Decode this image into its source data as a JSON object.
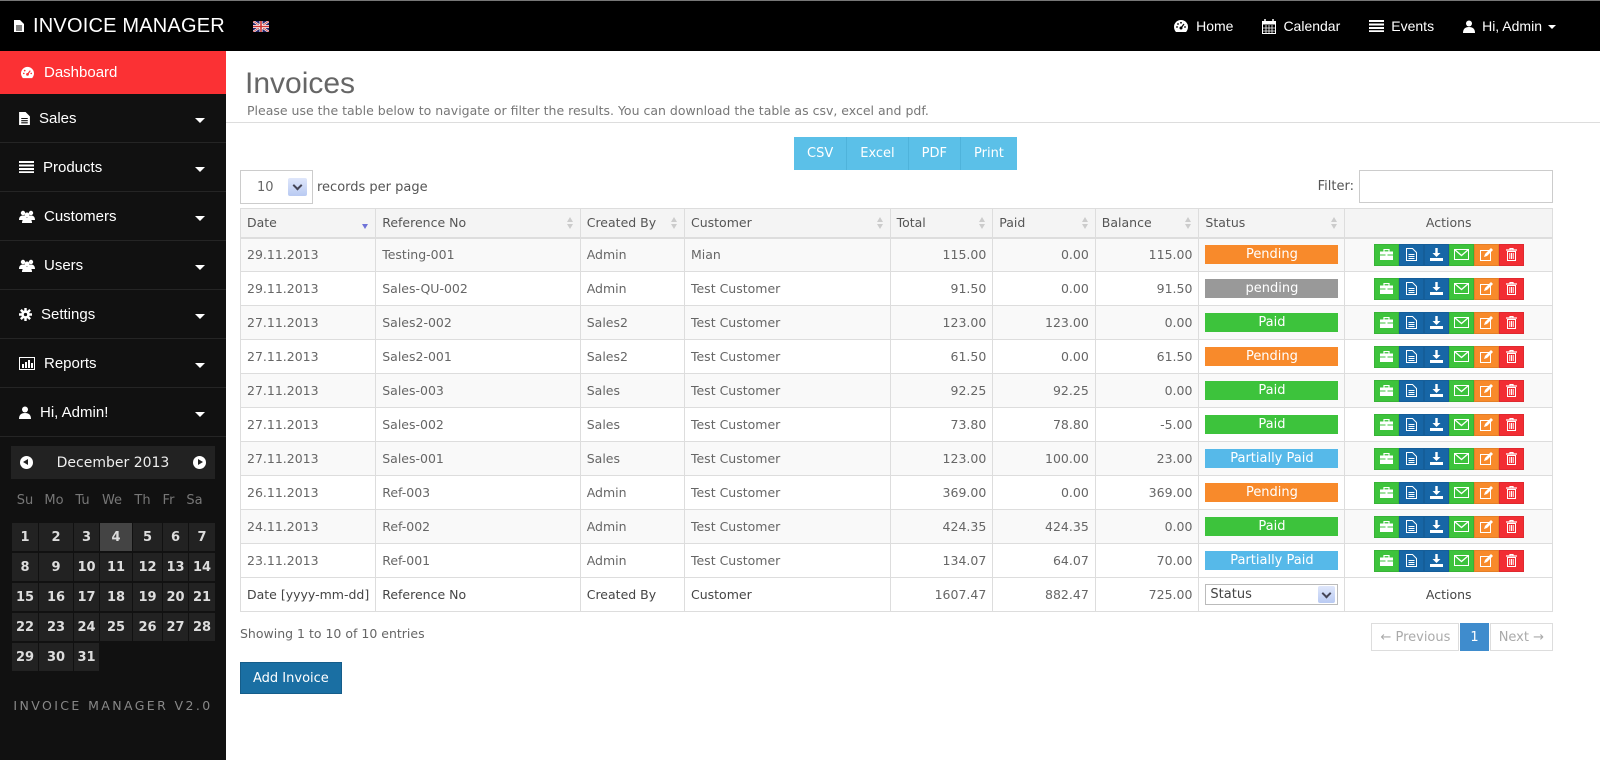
{
  "app": {
    "title": "INVOICE MANAGER",
    "version": "INVOICE MANAGER V2.0"
  },
  "topnav": {
    "items": [
      {
        "label": "Home",
        "icon": "dashboard-icon"
      },
      {
        "label": "Calendar",
        "icon": "calendar-icon"
      },
      {
        "label": "Events",
        "icon": "list-icon"
      },
      {
        "label": "Hi, Admin",
        "icon": "user-icon"
      }
    ]
  },
  "sidebar": {
    "items": [
      {
        "label": "Dashboard",
        "icon": "dashboard-icon",
        "active": true
      },
      {
        "label": "Sales",
        "icon": "file-icon"
      },
      {
        "label": "Products",
        "icon": "list-icon"
      },
      {
        "label": "Customers",
        "icon": "group-icon"
      },
      {
        "label": "Users",
        "icon": "group-icon"
      },
      {
        "label": "Settings",
        "icon": "gear-icon"
      },
      {
        "label": "Reports",
        "icon": "bar-chart-icon"
      },
      {
        "label": "Hi, Admin!",
        "icon": "user-icon"
      }
    ]
  },
  "calendar": {
    "month_label": "December 2013",
    "weekdays": [
      "Su",
      "Mo",
      "Tu",
      "We",
      "Th",
      "Fr",
      "Sa"
    ],
    "days": [
      "1",
      "2",
      "3",
      "4",
      "5",
      "6",
      "7",
      "8",
      "9",
      "10",
      "11",
      "12",
      "13",
      "14",
      "15",
      "16",
      "17",
      "18",
      "19",
      "20",
      "21",
      "22",
      "23",
      "24",
      "25",
      "26",
      "27",
      "28",
      "29",
      "30",
      "31"
    ],
    "today": "4"
  },
  "page": {
    "title": "Invoices",
    "subtitle": "Please use the table below to navigate or filter the results. You can download the table as csv, excel and pdf."
  },
  "export_buttons": [
    "CSV",
    "Excel",
    "PDF",
    "Print"
  ],
  "length": {
    "value": "10",
    "label": "records per page"
  },
  "filter": {
    "label": "Filter:",
    "value": ""
  },
  "table": {
    "columns": [
      "Date",
      "Reference No",
      "Created By",
      "Customer",
      "Total",
      "Paid",
      "Balance",
      "Status",
      "Actions"
    ],
    "rows": [
      {
        "date": "29.11.2013",
        "ref": "Testing-001",
        "created_by": "Admin",
        "customer": "Mian",
        "total": "115.00",
        "paid": "0.00",
        "balance": "115.00",
        "status": "Pending",
        "status_color": "#f88a2b"
      },
      {
        "date": "29.11.2013",
        "ref": "Sales-QU-002",
        "created_by": "Admin",
        "customer": "Test Customer",
        "total": "91.50",
        "paid": "0.00",
        "balance": "91.50",
        "status": "pending",
        "status_color": "#999999"
      },
      {
        "date": "27.11.2013",
        "ref": "Sales2-002",
        "created_by": "Sales2",
        "customer": "Test Customer",
        "total": "123.00",
        "paid": "123.00",
        "balance": "0.00",
        "status": "Paid",
        "status_color": "#3dc33c"
      },
      {
        "date": "27.11.2013",
        "ref": "Sales2-001",
        "created_by": "Sales2",
        "customer": "Test Customer",
        "total": "61.50",
        "paid": "0.00",
        "balance": "61.50",
        "status": "Pending",
        "status_color": "#f88a2b"
      },
      {
        "date": "27.11.2013",
        "ref": "Sales-003",
        "created_by": "Sales",
        "customer": "Test Customer",
        "total": "92.25",
        "paid": "92.25",
        "balance": "0.00",
        "status": "Paid",
        "status_color": "#3dc33c"
      },
      {
        "date": "27.11.2013",
        "ref": "Sales-002",
        "created_by": "Sales",
        "customer": "Test Customer",
        "total": "73.80",
        "paid": "78.80",
        "balance": "-5.00",
        "status": "Paid",
        "status_color": "#3dc33c"
      },
      {
        "date": "27.11.2013",
        "ref": "Sales-001",
        "created_by": "Sales",
        "customer": "Test Customer",
        "total": "123.00",
        "paid": "100.00",
        "balance": "23.00",
        "status": "Partially Paid",
        "status_color": "#56b9e9"
      },
      {
        "date": "26.11.2013",
        "ref": "Ref-003",
        "created_by": "Admin",
        "customer": "Test Customer",
        "total": "369.00",
        "paid": "0.00",
        "balance": "369.00",
        "status": "Pending",
        "status_color": "#f88a2b"
      },
      {
        "date": "24.11.2013",
        "ref": "Ref-002",
        "created_by": "Admin",
        "customer": "Test Customer",
        "total": "424.35",
        "paid": "424.35",
        "balance": "0.00",
        "status": "Paid",
        "status_color": "#3dc33c"
      },
      {
        "date": "23.11.2013",
        "ref": "Ref-001",
        "created_by": "Admin",
        "customer": "Test Customer",
        "total": "134.07",
        "paid": "64.07",
        "balance": "70.00",
        "status": "Partially Paid",
        "status_color": "#56b9e9"
      }
    ],
    "actions": [
      {
        "name": "payment-button",
        "icon": "briefcase-icon",
        "color": "green"
      },
      {
        "name": "view-button",
        "icon": "document-icon",
        "color": "blue"
      },
      {
        "name": "download-button",
        "icon": "download-icon",
        "color": "blue"
      },
      {
        "name": "email-button",
        "icon": "envelope-icon",
        "color": "green"
      },
      {
        "name": "edit-button",
        "icon": "edit-icon",
        "color": "orange"
      },
      {
        "name": "delete-button",
        "icon": "trash-icon",
        "color": "red"
      }
    ],
    "footer": {
      "date": "Date [yyyy-mm-dd]",
      "ref": "Reference No",
      "created_by": "Created By",
      "customer": "Customer",
      "total": "1607.47",
      "paid": "882.47",
      "balance": "725.00",
      "status_select": "Status",
      "actions": "Actions"
    }
  },
  "info": "Showing 1 to 10 of 10 entries",
  "pagination": {
    "previous": "← Previous",
    "current": "1",
    "next": "Next →"
  },
  "add_button": "Add Invoice"
}
